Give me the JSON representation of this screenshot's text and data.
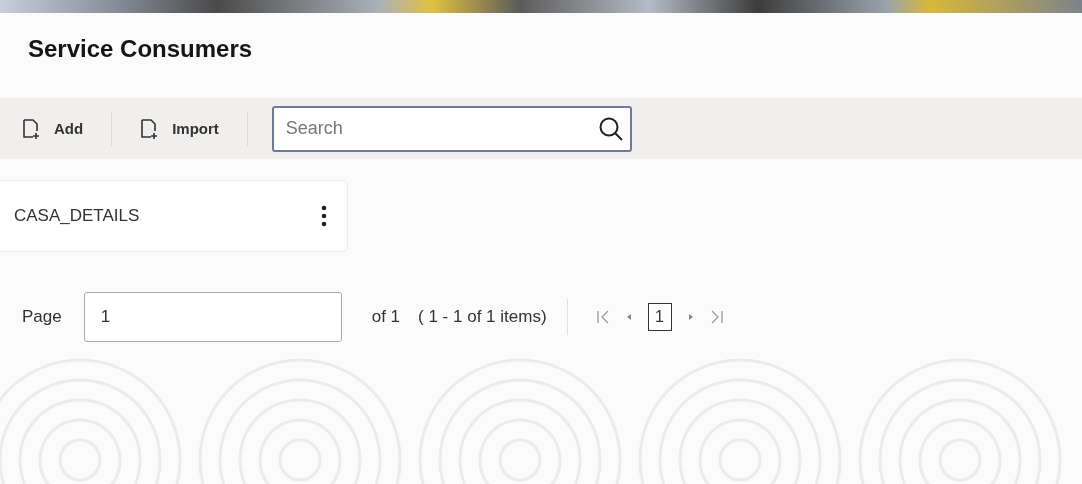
{
  "header": {
    "title": "Service Consumers"
  },
  "toolbar": {
    "buttons": [
      {
        "label": "Add"
      },
      {
        "label": "Import"
      }
    ],
    "search": {
      "placeholder": "Search"
    }
  },
  "cards": [
    {
      "name": "CASA_DETAILS"
    }
  ],
  "pagination": {
    "label": "Page",
    "value": "1",
    "of_total": "of 1",
    "range": "( 1 - 1 of 1 items)",
    "pages": [
      {
        "label": "1",
        "selected": true
      }
    ]
  }
}
